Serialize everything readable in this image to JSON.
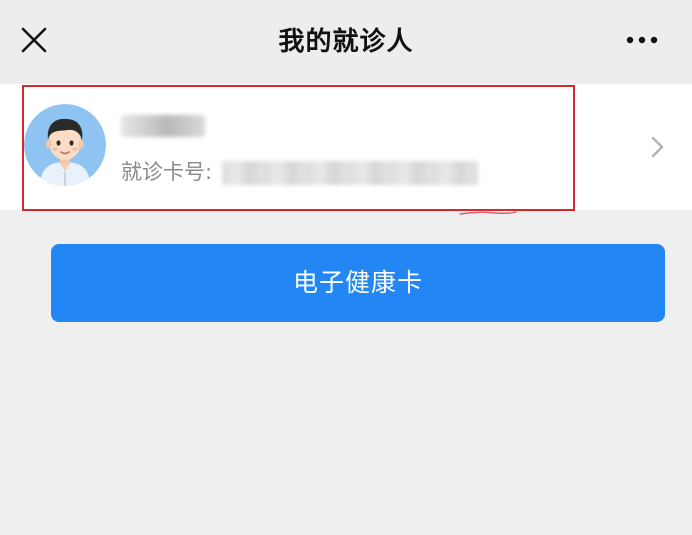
{
  "navbar": {
    "title": "我的就诊人",
    "close_icon": "close-icon",
    "more_icon": "more-horizontal-icon"
  },
  "patient": {
    "name": "",
    "card_number_label": "就诊卡号:",
    "card_number": "",
    "avatar_icon": "male-avatar-icon",
    "chevron_icon": "chevron-right-icon"
  },
  "actions": {
    "health_card_label": "电子健康卡"
  },
  "colors": {
    "primary_button": "#2386f5",
    "highlight_border": "#d7272f",
    "page_background": "#efefef",
    "avatar_background": "#8ec3f2"
  }
}
